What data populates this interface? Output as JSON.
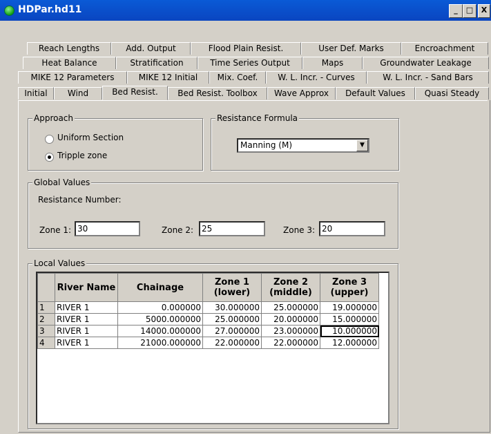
{
  "window": {
    "title": "HDPar.hd11",
    "min_label": "_",
    "max_label": "□",
    "close_label": "X"
  },
  "tabs": {
    "row1": [
      "Reach Lengths",
      "Add. Output",
      "Flood Plain Resist.",
      "User Def. Marks",
      "Encroachment"
    ],
    "row2": [
      "Heat Balance",
      "Stratification",
      "Time Series Output",
      "Maps",
      "Groundwater Leakage"
    ],
    "row3": [
      "MIKE 12 Parameters",
      "MIKE 12 Initial",
      "Mix. Coef.",
      "W. L. Incr. - Curves",
      "W. L. Incr. - Sand Bars"
    ],
    "row4": [
      "Initial",
      "Wind",
      "Bed Resist.",
      "Bed Resist. Toolbox",
      "Wave Approx",
      "Default Values",
      "Quasi Steady"
    ],
    "active": "Bed Resist."
  },
  "approach": {
    "label": "Approach",
    "options": [
      "Uniform Section",
      "Tripple zone"
    ],
    "selected": "Tripple zone"
  },
  "resistance_formula": {
    "label": "Resistance Formula",
    "value": "Manning (M)"
  },
  "global_values": {
    "label": "Global Values",
    "resistance_number_label": "Resistance Number:",
    "zone1_label": "Zone 1:",
    "zone1_value": "30",
    "zone2_label": "Zone 2:",
    "zone2_value": "25",
    "zone3_label": "Zone 3:",
    "zone3_value": "20"
  },
  "local_values": {
    "label": "Local Values",
    "columns": [
      "River Name",
      "Chainage",
      "Zone 1\n(lower)",
      "Zone 2\n(middle)",
      "Zone 3\n(upper)"
    ],
    "rows": [
      [
        "1",
        "RIVER 1",
        "0.000000",
        "30.000000",
        "25.000000",
        "19.000000"
      ],
      [
        "2",
        "RIVER 1",
        "5000.000000",
        "25.000000",
        "20.000000",
        "15.000000"
      ],
      [
        "3",
        "RIVER 1",
        "14000.000000",
        "27.000000",
        "23.000000",
        "10.000000"
      ],
      [
        "4",
        "RIVER 1",
        "21000.000000",
        "22.000000",
        "22.000000",
        "12.000000"
      ]
    ]
  }
}
